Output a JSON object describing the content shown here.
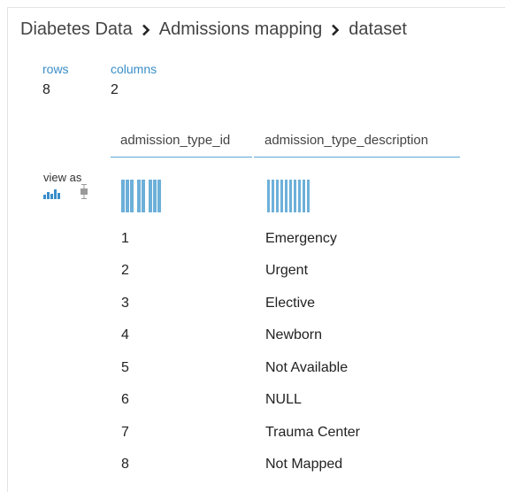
{
  "breadcrumb": {
    "items": [
      "Diabetes Data",
      "Admissions mapping",
      "dataset"
    ]
  },
  "stats": {
    "rows_label": "rows",
    "rows_value": "8",
    "columns_label": "columns",
    "columns_value": "2"
  },
  "table": {
    "columns": [
      "admission_type_id",
      "admission_type_description"
    ],
    "rows": [
      [
        "1",
        "Emergency"
      ],
      [
        "2",
        "Urgent"
      ],
      [
        "3",
        "Elective"
      ],
      [
        "4",
        "Newborn"
      ],
      [
        "5",
        "Not Available"
      ],
      [
        "6",
        "NULL"
      ],
      [
        "7",
        "Trauma Center"
      ],
      [
        "8",
        "Not Mapped"
      ]
    ]
  },
  "view_as": {
    "label": "view as",
    "options": [
      "histogram-icon",
      "boxplot-icon"
    ],
    "selected": "histogram-icon"
  },
  "colors": {
    "accent": "#3a8ec9",
    "bar": "#6db0d9",
    "header_underline": "#5ca7d6"
  }
}
